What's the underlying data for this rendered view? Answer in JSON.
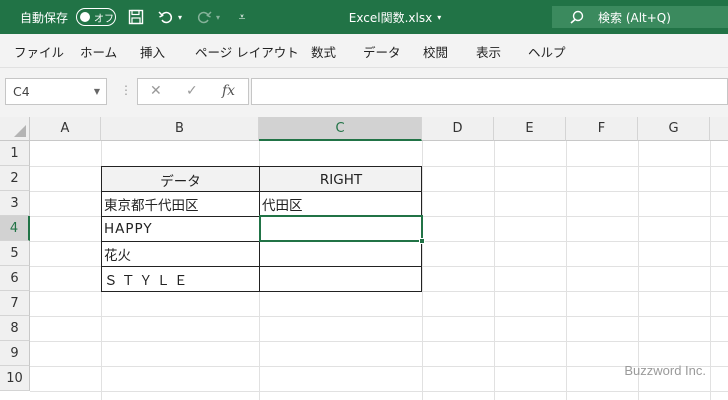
{
  "titlebar": {
    "autosave_label": "自動保存",
    "toggle_label": "オフ",
    "filename": "Excel関数.xlsx",
    "search_label": "検索 (Alt+Q)"
  },
  "ribbon": {
    "tabs": [
      "ファイル",
      "ホーム",
      "挿入",
      "ページ レイアウト",
      "数式",
      "データ",
      "校閲",
      "表示",
      "ヘルプ"
    ]
  },
  "formula_bar": {
    "name_box": "C4",
    "fx_label": "fx",
    "formula": ""
  },
  "sheet": {
    "columns": [
      "A",
      "B",
      "C",
      "D",
      "E",
      "F",
      "G"
    ],
    "rows": [
      "1",
      "2",
      "3",
      "4",
      "5",
      "6",
      "7",
      "8",
      "9",
      "10"
    ],
    "selected_column": "C",
    "selected_row": "4",
    "cells": {
      "B2": "データ",
      "C2": "RIGHT",
      "B3": "東京都千代田区",
      "C3": "代田区",
      "B4": "HAPPY",
      "C4": "",
      "B5": "花火",
      "C5": "",
      "B6": "ＳＴＹＬＥ",
      "C6": ""
    }
  },
  "watermark": "Buzzword Inc.",
  "colors": {
    "accent": "#217346",
    "search_bg": "#3b8a5e",
    "ribbon_bg": "#f3f3f3"
  }
}
